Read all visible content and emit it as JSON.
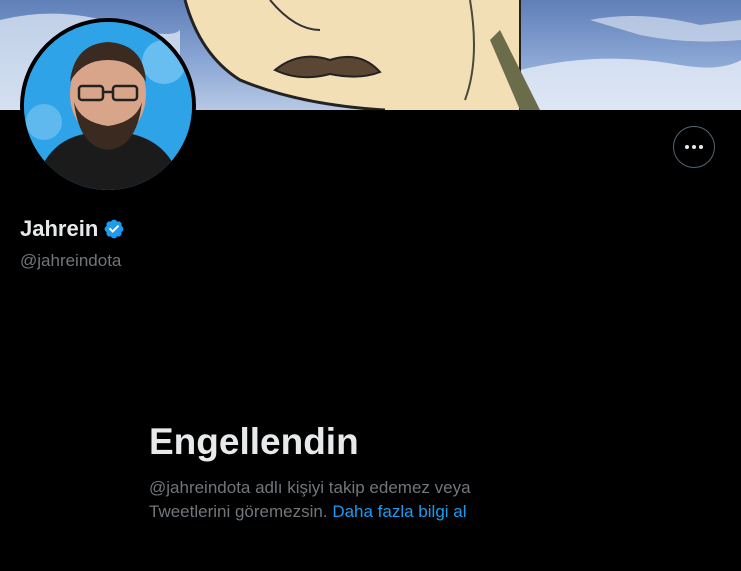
{
  "profile": {
    "name": "Jahrein",
    "handle": "@jahreindota"
  },
  "blocked": {
    "title": "Engellendin",
    "message": "@jahreindota adlı kişiyi takip edemez veya Tweetlerini göremezsin.",
    "link": "Daha fazla bilgi al"
  },
  "icons": {
    "more": "more-horizontal-icon",
    "verified": "verified-badge-icon"
  },
  "colors": {
    "background": "#000000",
    "primary_text": "#e7e9ea",
    "secondary_text": "#71767b",
    "link": "#1d9bf0",
    "verified": "#1d9bf0"
  }
}
